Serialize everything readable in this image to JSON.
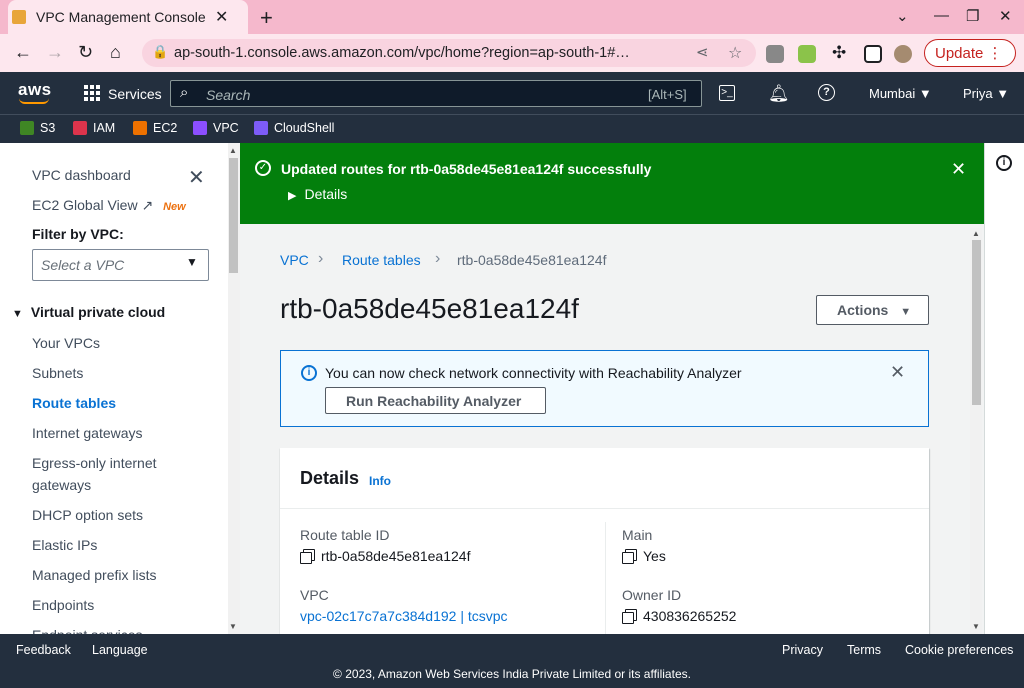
{
  "browser": {
    "tab_title": "VPC Management Console",
    "url": "ap-south-1.console.aws.amazon.com/vpc/home?region=ap-south-1#…",
    "update_label": "Update"
  },
  "aws_header": {
    "logo": "aws",
    "services_label": "Services",
    "search_placeholder": "Search",
    "search_shortcut": "[Alt+S]",
    "region": "Mumbai ▼",
    "user": "Priya ▼"
  },
  "favorites": [
    {
      "label": "S3",
      "color": "#3f8624"
    },
    {
      "label": "IAM",
      "color": "#dd344c"
    },
    {
      "label": "EC2",
      "color": "#ed7100"
    },
    {
      "label": "VPC",
      "color": "#8c4fff"
    },
    {
      "label": "CloudShell",
      "color": "#7d5cf7"
    }
  ],
  "sidebar": {
    "dashboard": "VPC dashboard",
    "ec2_global": "EC2 Global View",
    "new_badge": "New",
    "filter_label": "Filter by VPC:",
    "filter_placeholder": "Select a VPC",
    "section": "Virtual private cloud",
    "items": [
      "Your VPCs",
      "Subnets",
      "Route tables",
      "Internet gateways",
      "Egress-only internet",
      "gateways",
      "DHCP option sets",
      "Elastic IPs",
      "Managed prefix lists",
      "Endpoints",
      "Endpoint services"
    ],
    "active_item": "Route tables"
  },
  "flash": {
    "message": "Updated routes for rtb-0a58de45e81ea124f successfully",
    "details": "Details",
    "color": "#037f0c"
  },
  "breadcrumb": {
    "root": "VPC",
    "parent": "Route tables",
    "current": "rtb-0a58de45e81ea124f"
  },
  "page": {
    "title": "rtb-0a58de45e81ea124f",
    "actions_label": "Actions"
  },
  "info_alert": {
    "text": "You can now check network connectivity with Reachability Analyzer",
    "button": "Run Reachability Analyzer"
  },
  "details": {
    "heading": "Details",
    "info": "Info",
    "route_table_id_label": "Route table ID",
    "route_table_id": "rtb-0a58de45e81ea124f",
    "main_label": "Main",
    "main": "Yes",
    "vpc_label": "VPC",
    "vpc": "vpc-02c17c7a7c384d192 | tcsvpc",
    "owner_label": "Owner ID",
    "owner": "430836265252"
  },
  "footer": {
    "feedback": "Feedback",
    "language": "Language",
    "privacy": "Privacy",
    "terms": "Terms",
    "cookies": "Cookie preferences",
    "copyright": "© 2023, Amazon Web Services India Private Limited or its affiliates."
  }
}
